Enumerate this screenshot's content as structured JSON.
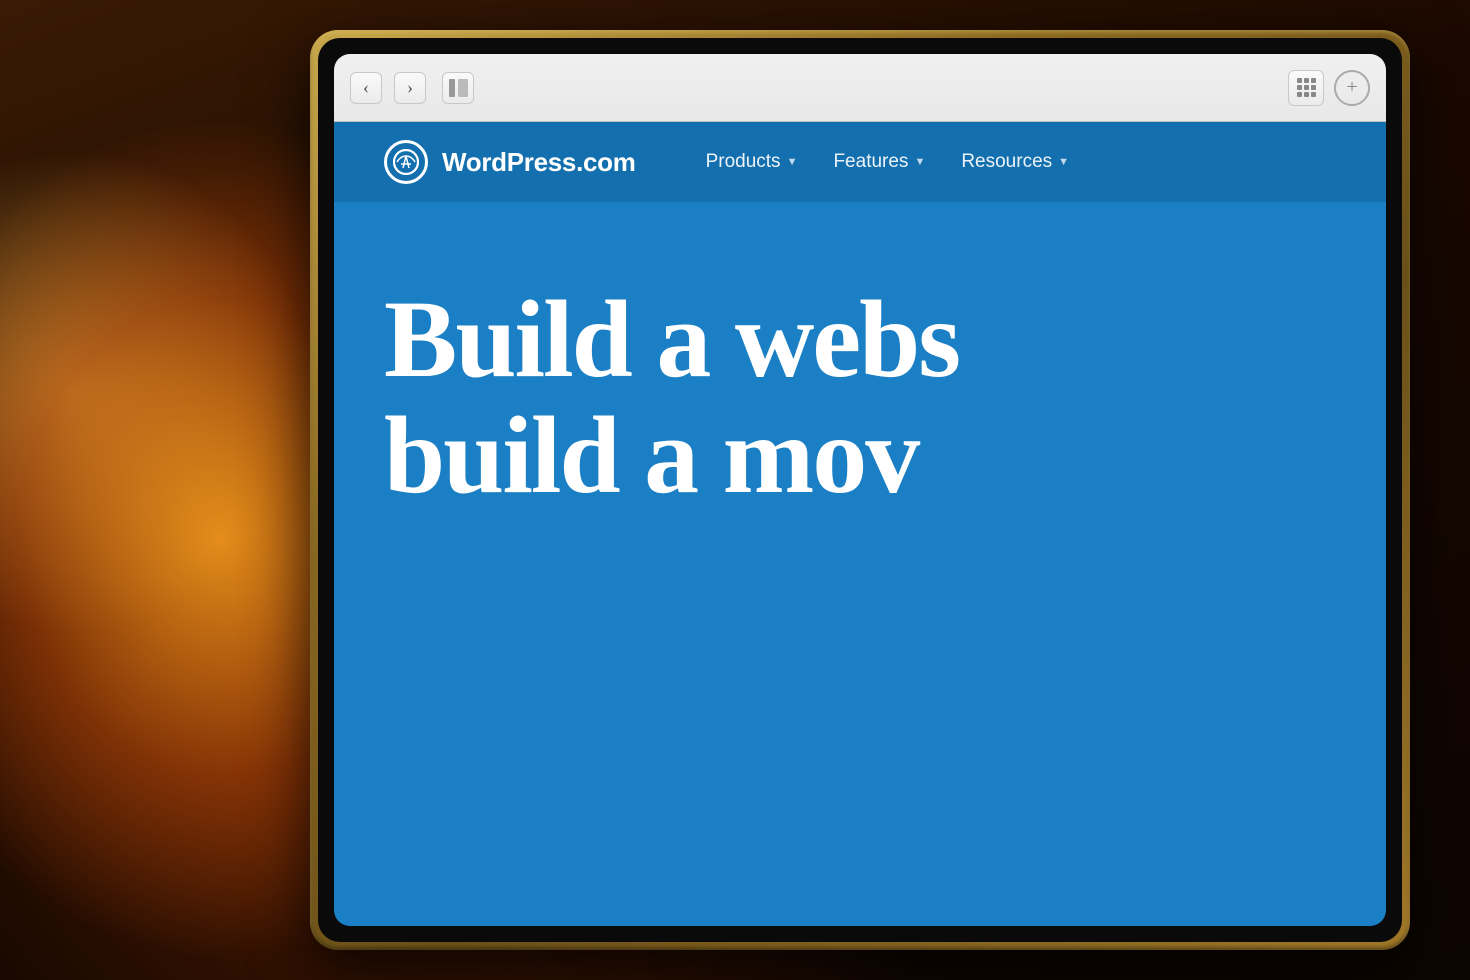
{
  "background": {
    "color": "#1a0800"
  },
  "browser": {
    "back_label": "‹",
    "forward_label": "›",
    "back_aria": "Back",
    "forward_aria": "Forward",
    "sidebar_aria": "Show Sidebar",
    "new_tab_aria": "New Tab",
    "grid_aria": "Open Grid"
  },
  "website": {
    "logo_icon": "W",
    "logo_text": "WordPress.com",
    "nav_items": [
      {
        "label": "Products",
        "has_dropdown": true
      },
      {
        "label": "Features",
        "has_dropdown": true
      },
      {
        "label": "Resources",
        "has_dropdown": true
      }
    ],
    "hero_line1": "Build a webs",
    "hero_line2": "build a mov"
  }
}
